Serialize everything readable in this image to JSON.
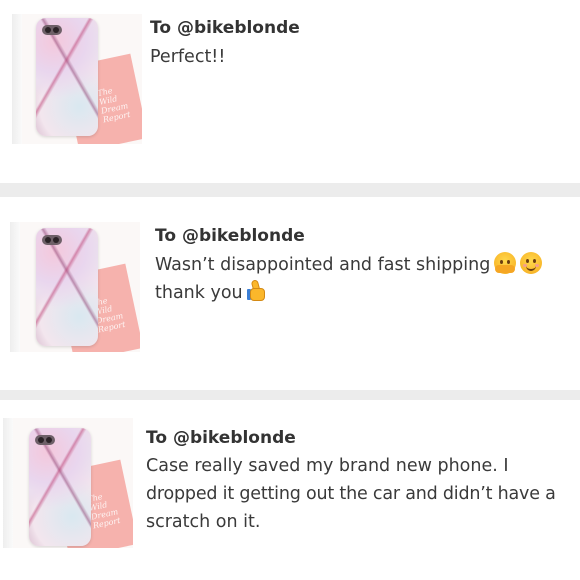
{
  "reviews": [
    {
      "to_prefix": "To ",
      "username": "@bikeblonde",
      "message_lines": [
        "Perfect!!"
      ]
    },
    {
      "to_prefix": "To ",
      "username": "@bikeblonde",
      "message_lines": [
        "Wasn’t disappointed and fast shipping",
        "thank you"
      ],
      "emojis": [
        "hugging-face-emoji",
        "smiling-face-emoji",
        "thumbs-up-emoji"
      ]
    },
    {
      "to_prefix": "To ",
      "username": "@bikeblonde",
      "message_lines": [
        "Case really saved my brand new phone. I",
        "dropped it getting out the car and didn’t have a",
        "scratch on it."
      ]
    }
  ],
  "thumbnail_card_text": [
    "The",
    "Wild",
    "Dream",
    "Report"
  ],
  "colors": {
    "background": "#ececec",
    "card": "#ffffff",
    "text": "#3a3a3a",
    "card_pink": "#f6b2ad"
  }
}
